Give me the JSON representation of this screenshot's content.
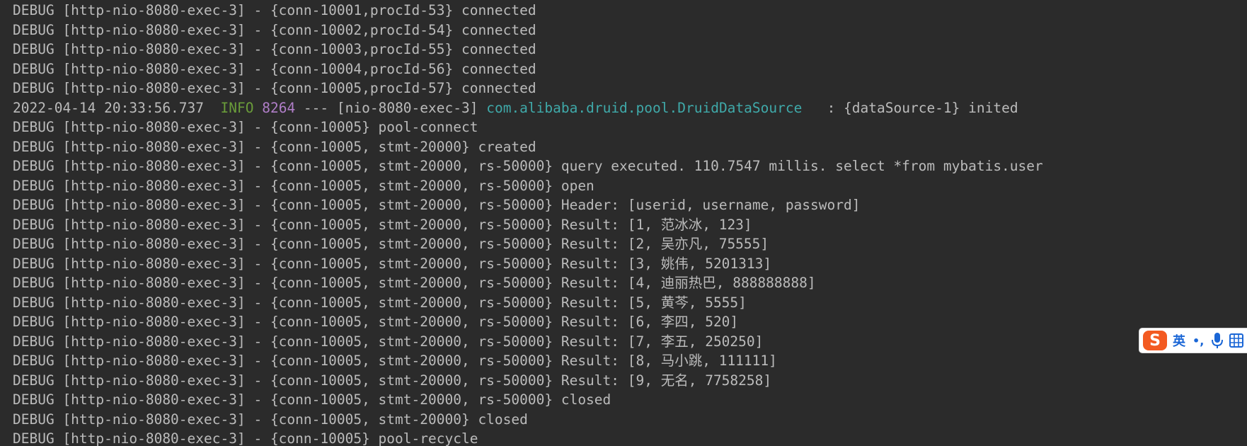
{
  "console": {
    "lines": [
      [
        {
          "t": "DEBUG [http-nio-8080-exec-3] - {conn-10001,procId-53} connected",
          "c": "default"
        }
      ],
      [
        {
          "t": "DEBUG [http-nio-8080-exec-3] - {conn-10002,procId-54} connected",
          "c": "default"
        }
      ],
      [
        {
          "t": "DEBUG [http-nio-8080-exec-3] - {conn-10003,procId-55} connected",
          "c": "default"
        }
      ],
      [
        {
          "t": "DEBUG [http-nio-8080-exec-3] - {conn-10004,procId-56} connected",
          "c": "default"
        }
      ],
      [
        {
          "t": "DEBUG [http-nio-8080-exec-3] - {conn-10005,procId-57} connected",
          "c": "default"
        }
      ],
      [
        {
          "t": "2022-04-14 20:33:56.737  ",
          "c": "default"
        },
        {
          "t": "INFO",
          "c": "info"
        },
        {
          "t": " ",
          "c": "default"
        },
        {
          "t": "8264",
          "c": "pid"
        },
        {
          "t": " --- [nio-8080-exec-3] ",
          "c": "default"
        },
        {
          "t": "com.alibaba.druid.pool.DruidDataSource",
          "c": "logger"
        },
        {
          "t": "   : {dataSource-1} inited",
          "c": "default"
        }
      ],
      [
        {
          "t": "DEBUG [http-nio-8080-exec-3] - {conn-10005} pool-connect",
          "c": "default"
        }
      ],
      [
        {
          "t": "DEBUG [http-nio-8080-exec-3] - {conn-10005, stmt-20000} created",
          "c": "default"
        }
      ],
      [
        {
          "t": "DEBUG [http-nio-8080-exec-3] - {conn-10005, stmt-20000, rs-50000} query executed. 110.7547 millis. select *from mybatis.user",
          "c": "default"
        }
      ],
      [
        {
          "t": "DEBUG [http-nio-8080-exec-3] - {conn-10005, stmt-20000, rs-50000} open",
          "c": "default"
        }
      ],
      [
        {
          "t": "DEBUG [http-nio-8080-exec-3] - {conn-10005, stmt-20000, rs-50000} Header: [userid, username, password]",
          "c": "default"
        }
      ],
      [
        {
          "t": "DEBUG [http-nio-8080-exec-3] - {conn-10005, stmt-20000, rs-50000} Result: [1, 范冰冰, 123]",
          "c": "default"
        }
      ],
      [
        {
          "t": "DEBUG [http-nio-8080-exec-3] - {conn-10005, stmt-20000, rs-50000} Result: [2, 吴亦凡, 75555]",
          "c": "default"
        }
      ],
      [
        {
          "t": "DEBUG [http-nio-8080-exec-3] - {conn-10005, stmt-20000, rs-50000} Result: [3, 姚伟, 5201313]",
          "c": "default"
        }
      ],
      [
        {
          "t": "DEBUG [http-nio-8080-exec-3] - {conn-10005, stmt-20000, rs-50000} Result: [4, 迪丽热巴, 888888888]",
          "c": "default"
        }
      ],
      [
        {
          "t": "DEBUG [http-nio-8080-exec-3] - {conn-10005, stmt-20000, rs-50000} Result: [5, 黄芩, 5555]",
          "c": "default"
        }
      ],
      [
        {
          "t": "DEBUG [http-nio-8080-exec-3] - {conn-10005, stmt-20000, rs-50000} Result: [6, 李四, 520]",
          "c": "default"
        }
      ],
      [
        {
          "t": "DEBUG [http-nio-8080-exec-3] - {conn-10005, stmt-20000, rs-50000} Result: [7, 李五, 250250]",
          "c": "default"
        }
      ],
      [
        {
          "t": "DEBUG [http-nio-8080-exec-3] - {conn-10005, stmt-20000, rs-50000} Result: [8, 马小跳, 111111]",
          "c": "default"
        }
      ],
      [
        {
          "t": "DEBUG [http-nio-8080-exec-3] - {conn-10005, stmt-20000, rs-50000} Result: [9, 无名, 7758258]",
          "c": "default"
        }
      ],
      [
        {
          "t": "DEBUG [http-nio-8080-exec-3] - {conn-10005, stmt-20000, rs-50000} closed",
          "c": "default"
        }
      ],
      [
        {
          "t": "DEBUG [http-nio-8080-exec-3] - {conn-10005, stmt-20000} closed",
          "c": "default"
        }
      ],
      [
        {
          "t": "DEBUG [http-nio-8080-exec-3] - {conn-10005} pool-recycle",
          "c": "default"
        }
      ]
    ]
  },
  "ime": {
    "logo": "S",
    "lang": "英",
    "punct": "•,",
    "icons": [
      "sogou-logo-icon",
      "microphone-icon",
      "grid-icon"
    ]
  },
  "colors": {
    "background": "#2b2b2b",
    "text": "#bbbbbb",
    "info": "#6a9c3a",
    "pid": "#b07ec8",
    "logger": "#3fa9a9",
    "ime_accent": "#f35a21",
    "ime_blue": "#1a66d6"
  }
}
